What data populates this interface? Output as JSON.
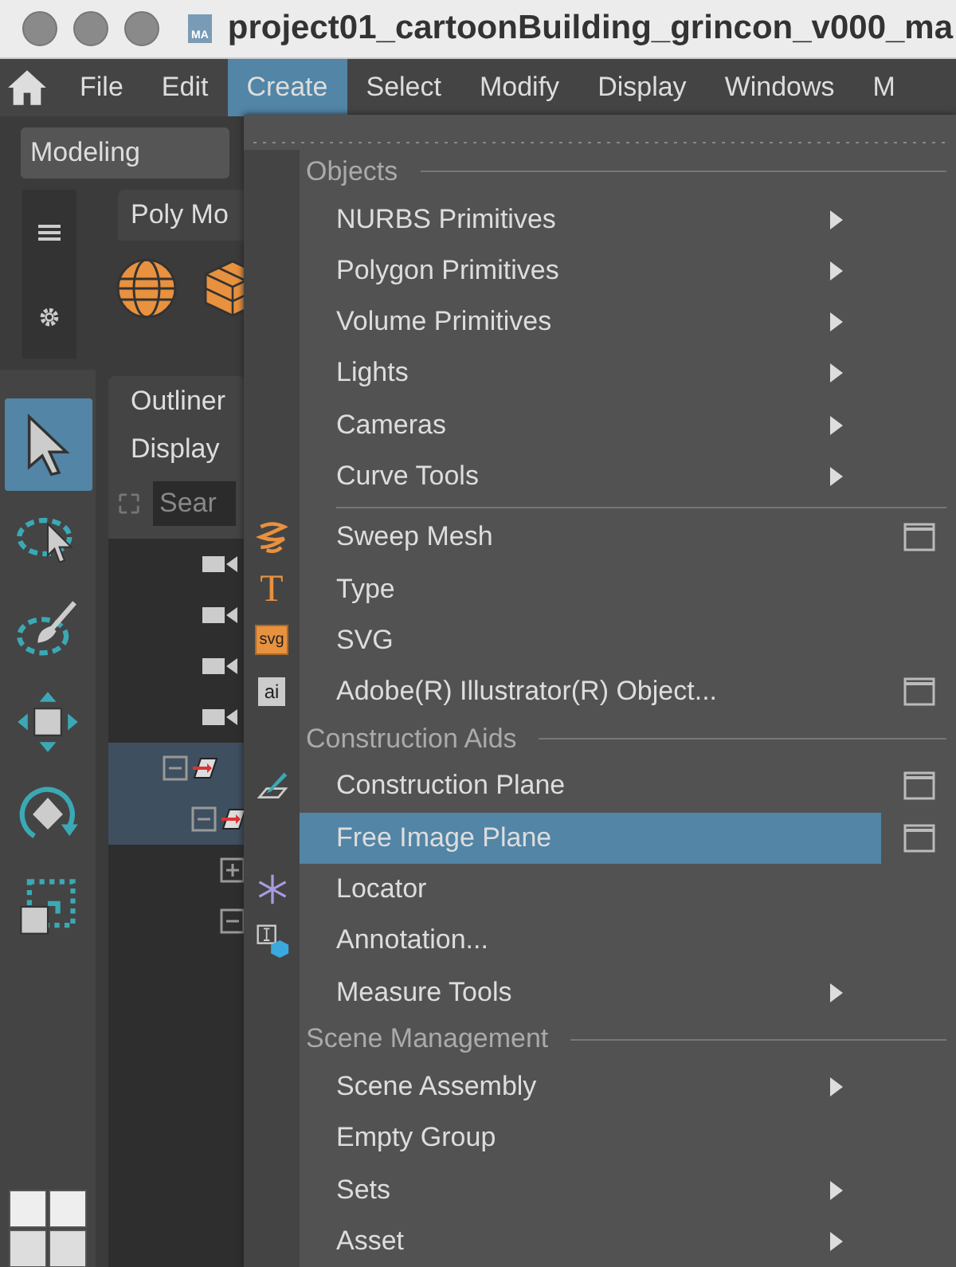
{
  "window": {
    "title": "project01_cartoonBuilding_grincon_v000_ma",
    "file_icon_text": "MA"
  },
  "menu_bar": [
    {
      "label": "File",
      "selected": false
    },
    {
      "label": "Edit",
      "selected": false
    },
    {
      "label": "Create",
      "selected": true
    },
    {
      "label": "Select",
      "selected": false
    },
    {
      "label": "Modify",
      "selected": false
    },
    {
      "label": "Display",
      "selected": false
    },
    {
      "label": "Windows",
      "selected": false
    },
    {
      "label": "M",
      "selected": false
    }
  ],
  "workspace": {
    "value": "Modeling"
  },
  "shelf": {
    "tab": "Poly Mo"
  },
  "tools": [
    {
      "kind": "select",
      "selected": true
    },
    {
      "kind": "lasso",
      "selected": false
    },
    {
      "kind": "paint",
      "selected": false
    },
    {
      "kind": "move",
      "selected": false
    },
    {
      "kind": "rotate",
      "selected": false
    },
    {
      "kind": "scale",
      "selected": false
    }
  ],
  "outliner": {
    "tab": "Outliner",
    "menu": "Display",
    "search_placeholder": "Sear",
    "items": [
      {
        "kind": "camera",
        "selected": false
      },
      {
        "kind": "camera",
        "selected": false
      },
      {
        "kind": "camera",
        "selected": false
      },
      {
        "kind": "camera",
        "selected": false
      },
      {
        "kind": "group",
        "selected": true,
        "expanded": true,
        "children": [
          {
            "kind": "group",
            "selected": true,
            "expanded": true,
            "children": [
              {
                "kind": "node",
                "selected": false,
                "expanded": false
              },
              {
                "kind": "node",
                "selected": false,
                "expanded": true
              }
            ]
          }
        ]
      }
    ]
  },
  "create_menu": {
    "sections": [
      {
        "title": "Objects",
        "items": [
          {
            "label": "NURBS Primitives",
            "kind": "plain",
            "submenu": true,
            "option_box": false,
            "selected": false
          },
          {
            "label": "Polygon Primitives",
            "kind": "plain",
            "submenu": true,
            "option_box": false,
            "selected": false
          },
          {
            "label": "Volume Primitives",
            "kind": "plain",
            "submenu": true,
            "option_box": false,
            "selected": false
          },
          {
            "label": "Lights",
            "kind": "plain",
            "submenu": true,
            "option_box": false,
            "selected": false
          },
          {
            "label": "Cameras",
            "kind": "plain",
            "submenu": true,
            "option_box": false,
            "selected": false
          },
          {
            "label": "Curve Tools",
            "kind": "plain",
            "submenu": true,
            "option_box": false,
            "selected": false,
            "divider_after": true
          },
          {
            "label": "Sweep Mesh",
            "kind": "sweep",
            "submenu": false,
            "option_box": true,
            "selected": false
          },
          {
            "label": "Type",
            "kind": "type",
            "submenu": false,
            "option_box": false,
            "selected": false,
            "icon_text": "T"
          },
          {
            "label": "SVG",
            "kind": "svg",
            "submenu": false,
            "option_box": false,
            "selected": false,
            "icon_text": "svg"
          },
          {
            "label": "Adobe(R) Illustrator(R) Object...",
            "kind": "ai",
            "submenu": false,
            "option_box": true,
            "selected": false,
            "icon_text": "ai"
          }
        ]
      },
      {
        "title": "Construction Aids",
        "items": [
          {
            "label": "Construction Plane",
            "kind": "plane",
            "submenu": false,
            "option_box": true,
            "selected": false
          },
          {
            "label": "Free Image Plane",
            "kind": "plain",
            "submenu": false,
            "option_box": true,
            "selected": true
          },
          {
            "label": "Locator",
            "kind": "locator",
            "submenu": false,
            "option_box": false,
            "selected": false
          },
          {
            "label": "Annotation...",
            "kind": "annotation",
            "submenu": false,
            "option_box": false,
            "selected": false
          },
          {
            "label": "Measure Tools",
            "kind": "plain",
            "submenu": true,
            "option_box": false,
            "selected": false
          }
        ]
      },
      {
        "title": "Scene Management",
        "items": [
          {
            "label": "Scene Assembly",
            "kind": "plain",
            "submenu": true,
            "option_box": false,
            "selected": false
          },
          {
            "label": "Empty Group",
            "kind": "plain",
            "submenu": false,
            "option_box": false,
            "selected": false
          },
          {
            "label": "Sets",
            "kind": "plain",
            "submenu": true,
            "option_box": false,
            "selected": false
          },
          {
            "label": "Asset",
            "kind": "plain",
            "submenu": true,
            "option_box": false,
            "selected": false
          }
        ]
      }
    ]
  }
}
